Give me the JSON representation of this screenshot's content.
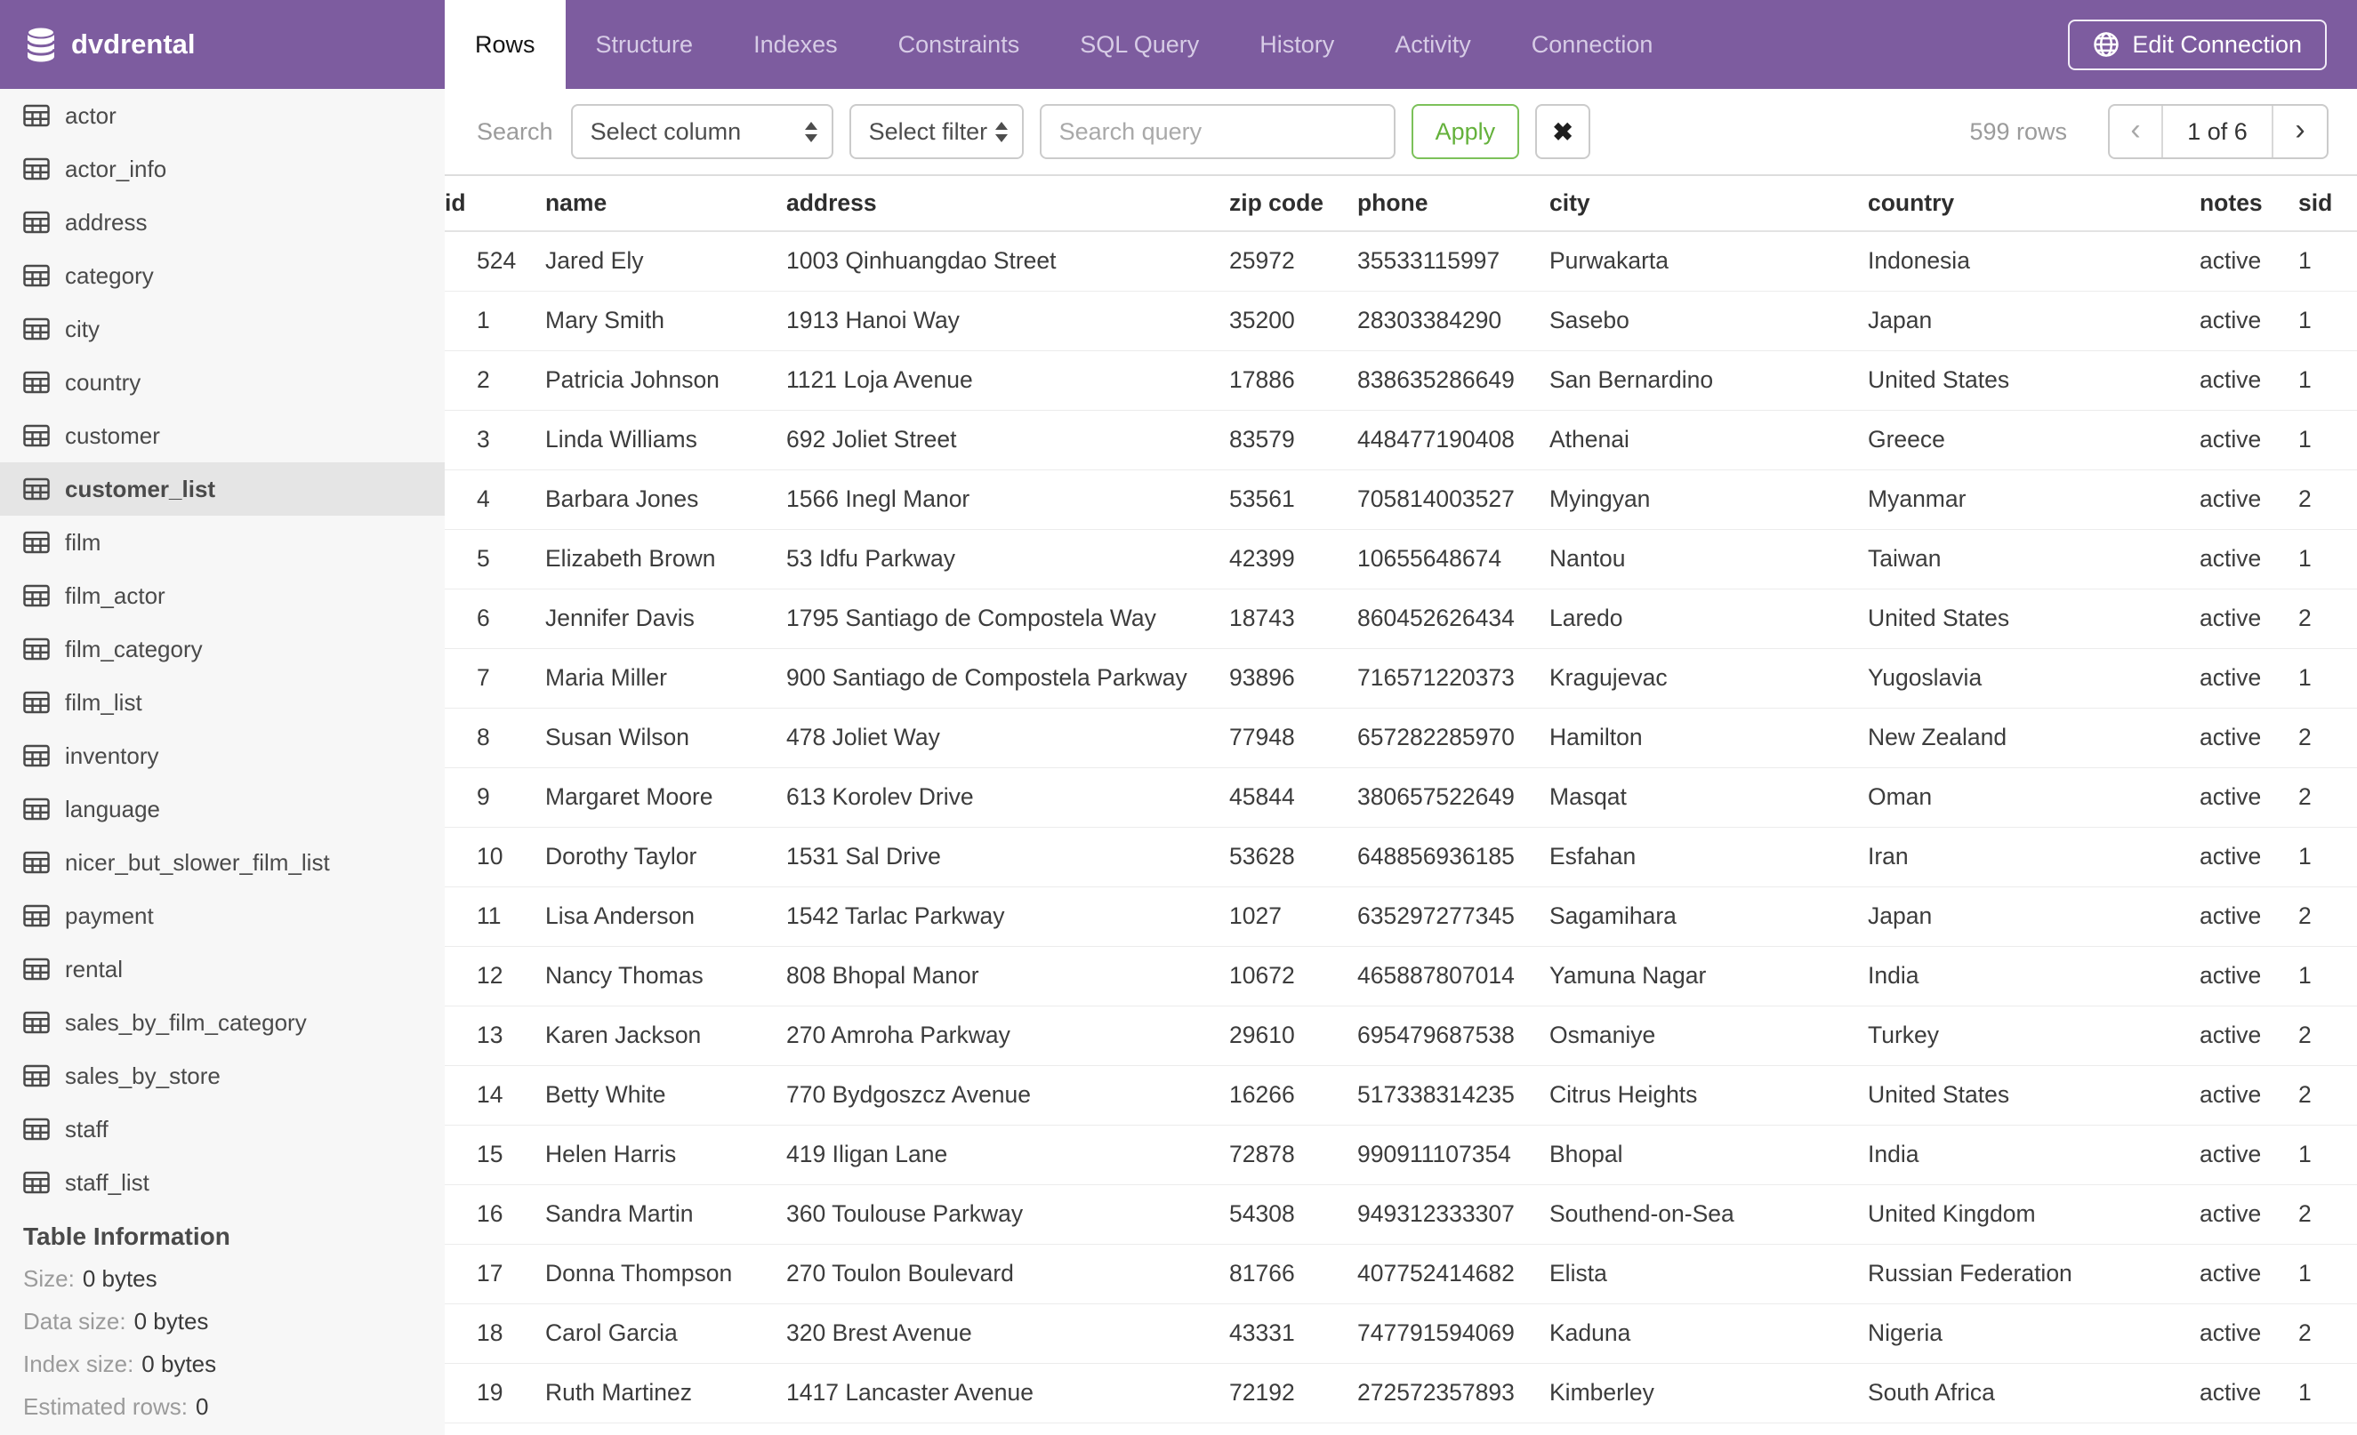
{
  "app": {
    "database_name": "dvdrental"
  },
  "colors": {
    "header_purple": "#7D5C9F",
    "apply_green": "#64B13B",
    "sidebar_bg": "#F7F7F7",
    "selected_item_bg": "#E5E5E5"
  },
  "header": {
    "tabs": [
      {
        "label": "Rows",
        "active": true
      },
      {
        "label": "Structure"
      },
      {
        "label": "Indexes"
      },
      {
        "label": "Constraints"
      },
      {
        "label": "SQL Query"
      },
      {
        "label": "History"
      },
      {
        "label": "Activity"
      },
      {
        "label": "Connection"
      }
    ],
    "edit_connection_label": "Edit Connection"
  },
  "sidebar": {
    "tables": [
      {
        "name": "actor"
      },
      {
        "name": "actor_info"
      },
      {
        "name": "address"
      },
      {
        "name": "category"
      },
      {
        "name": "city"
      },
      {
        "name": "country"
      },
      {
        "name": "customer"
      },
      {
        "name": "customer_list",
        "selected": true
      },
      {
        "name": "film"
      },
      {
        "name": "film_actor"
      },
      {
        "name": "film_category"
      },
      {
        "name": "film_list"
      },
      {
        "name": "inventory"
      },
      {
        "name": "language"
      },
      {
        "name": "nicer_but_slower_film_list"
      },
      {
        "name": "payment"
      },
      {
        "name": "rental"
      },
      {
        "name": "sales_by_film_category"
      },
      {
        "name": "sales_by_store"
      },
      {
        "name": "staff"
      },
      {
        "name": "staff_list"
      }
    ],
    "table_information": {
      "heading": "Table Information",
      "rows": [
        {
          "label": "Size:",
          "value": "0 bytes"
        },
        {
          "label": "Data size:",
          "value": "0 bytes"
        },
        {
          "label": "Index size:",
          "value": "0 bytes"
        },
        {
          "label": "Estimated rows:",
          "value": "0"
        }
      ]
    }
  },
  "toolbar": {
    "search_label": "Search",
    "select_column_value": "Select column",
    "select_filter_value": "Select filter",
    "search_placeholder": "Search query",
    "apply_label": "Apply",
    "clear_label": "✖",
    "row_count": "599 rows",
    "pagination": {
      "prev": "‹",
      "current": "1 of 6",
      "next": "›"
    }
  },
  "table": {
    "columns": [
      "id",
      "name",
      "address",
      "zip code",
      "phone",
      "city",
      "country",
      "notes",
      "sid"
    ],
    "rows": [
      [
        "524",
        "Jared Ely",
        "1003 Qinhuangdao Street",
        "25972",
        "35533115997",
        "Purwakarta",
        "Indonesia",
        "active",
        "1"
      ],
      [
        "1",
        "Mary Smith",
        "1913 Hanoi Way",
        "35200",
        "28303384290",
        "Sasebo",
        "Japan",
        "active",
        "1"
      ],
      [
        "2",
        "Patricia Johnson",
        "1121 Loja Avenue",
        "17886",
        "838635286649",
        "San Bernardino",
        "United States",
        "active",
        "1"
      ],
      [
        "3",
        "Linda Williams",
        "692 Joliet Street",
        "83579",
        "448477190408",
        "Athenai",
        "Greece",
        "active",
        "1"
      ],
      [
        "4",
        "Barbara Jones",
        "1566 Inegl Manor",
        "53561",
        "705814003527",
        "Myingyan",
        "Myanmar",
        "active",
        "2"
      ],
      [
        "5",
        "Elizabeth Brown",
        "53 Idfu Parkway",
        "42399",
        "10655648674",
        "Nantou",
        "Taiwan",
        "active",
        "1"
      ],
      [
        "6",
        "Jennifer Davis",
        "1795 Santiago de Compostela Way",
        "18743",
        "860452626434",
        "Laredo",
        "United States",
        "active",
        "2"
      ],
      [
        "7",
        "Maria Miller",
        "900 Santiago de Compostela Parkway",
        "93896",
        "716571220373",
        "Kragujevac",
        "Yugoslavia",
        "active",
        "1"
      ],
      [
        "8",
        "Susan Wilson",
        "478 Joliet Way",
        "77948",
        "657282285970",
        "Hamilton",
        "New Zealand",
        "active",
        "2"
      ],
      [
        "9",
        "Margaret Moore",
        "613 Korolev Drive",
        "45844",
        "380657522649",
        "Masqat",
        "Oman",
        "active",
        "2"
      ],
      [
        "10",
        "Dorothy Taylor",
        "1531 Sal Drive",
        "53628",
        "648856936185",
        "Esfahan",
        "Iran",
        "active",
        "1"
      ],
      [
        "11",
        "Lisa Anderson",
        "1542 Tarlac Parkway",
        "1027",
        "635297277345",
        "Sagamihara",
        "Japan",
        "active",
        "2"
      ],
      [
        "12",
        "Nancy Thomas",
        "808 Bhopal Manor",
        "10672",
        "465887807014",
        "Yamuna Nagar",
        "India",
        "active",
        "1"
      ],
      [
        "13",
        "Karen Jackson",
        "270 Amroha Parkway",
        "29610",
        "695479687538",
        "Osmaniye",
        "Turkey",
        "active",
        "2"
      ],
      [
        "14",
        "Betty White",
        "770 Bydgoszcz Avenue",
        "16266",
        "517338314235",
        "Citrus Heights",
        "United States",
        "active",
        "2"
      ],
      [
        "15",
        "Helen Harris",
        "419 Iligan Lane",
        "72878",
        "990911107354",
        "Bhopal",
        "India",
        "active",
        "1"
      ],
      [
        "16",
        "Sandra Martin",
        "360 Toulouse Parkway",
        "54308",
        "949312333307",
        "Southend-on-Sea",
        "United Kingdom",
        "active",
        "2"
      ],
      [
        "17",
        "Donna Thompson",
        "270 Toulon Boulevard",
        "81766",
        "407752414682",
        "Elista",
        "Russian Federation",
        "active",
        "1"
      ],
      [
        "18",
        "Carol Garcia",
        "320 Brest Avenue",
        "43331",
        "747791594069",
        "Kaduna",
        "Nigeria",
        "active",
        "2"
      ],
      [
        "19",
        "Ruth Martinez",
        "1417 Lancaster Avenue",
        "72192",
        "272572357893",
        "Kimberley",
        "South Africa",
        "active",
        "1"
      ]
    ]
  }
}
